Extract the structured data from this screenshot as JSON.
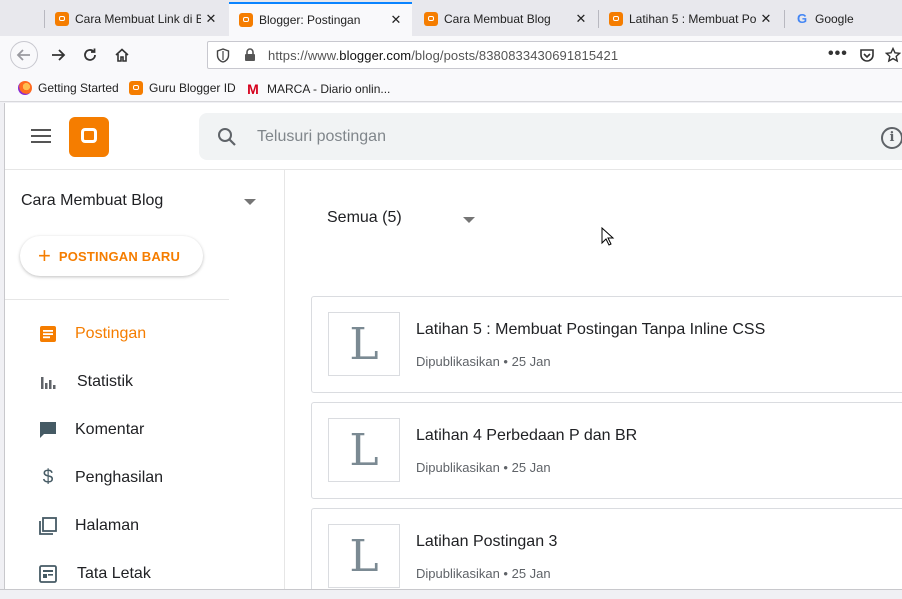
{
  "browser": {
    "tabs": [
      {
        "title": "Cara Membuat Link di Bl",
        "icon": "blogger-icon"
      },
      {
        "title": "Blogger: Postingan",
        "icon": "blogger-icon",
        "active": true
      },
      {
        "title": "Cara Membuat Blog",
        "icon": "blogger-icon"
      },
      {
        "title": "Latihan 5 : Membuat Po",
        "icon": "blogger-icon"
      },
      {
        "title": "Google",
        "icon": "google-icon"
      }
    ],
    "url_prefix": "https://www.",
    "url_domain": "blogger.com",
    "url_path": "/blog/posts/8380833430691815421",
    "bookmarks": [
      {
        "label": "Getting Started",
        "icon": "firefox-icon"
      },
      {
        "label": "Guru Blogger ID",
        "icon": "blogger-icon"
      },
      {
        "label": "MARCA - Diario onlin...",
        "icon": "marca-icon"
      }
    ],
    "accent": "#0a84ff"
  },
  "app": {
    "search_placeholder": "Telusuri postingan",
    "blog_name": "Cara Membuat Blog",
    "new_post_label": "POSTINGAN BARU",
    "brand_color": "#f57d00",
    "nav": [
      {
        "label": "Postingan",
        "icon": "posts-icon",
        "active": true
      },
      {
        "label": "Statistik",
        "icon": "stats-icon"
      },
      {
        "label": "Komentar",
        "icon": "comment-icon"
      },
      {
        "label": "Penghasilan",
        "icon": "dollar-icon"
      },
      {
        "label": "Halaman",
        "icon": "pages-icon"
      },
      {
        "label": "Tata Letak",
        "icon": "layout-icon"
      }
    ],
    "filter_label": "Semua (5)",
    "posts": [
      {
        "thumb": "L",
        "title": "Latihan 5 : Membuat Postingan Tanpa Inline CSS",
        "status": "Dipublikasikan • 25 Jan"
      },
      {
        "thumb": "L",
        "title": "Latihan 4 Perbedaan P dan BR",
        "status": "Dipublikasikan • 25 Jan"
      },
      {
        "thumb": "L",
        "title": "Latihan Postingan 3",
        "status": "Dipublikasikan • 25 Jan"
      }
    ]
  }
}
